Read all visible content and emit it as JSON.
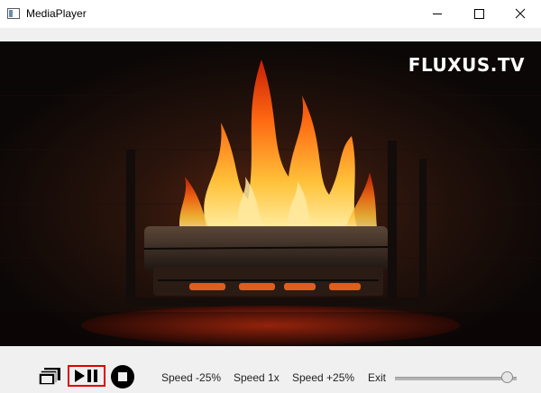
{
  "window": {
    "title": "MediaPlayer",
    "minimize_icon": "minimize-icon",
    "maximize_icon": "maximize-icon",
    "close_icon": "close-icon"
  },
  "video": {
    "watermark": "FLUXUS.TV"
  },
  "controls": {
    "fullscreen_icon": "fullscreen-icon",
    "playpause_icon": "play-pause-icon",
    "stop_icon": "stop-icon",
    "speed_down_label": "Speed -25%",
    "speed_normal_label": "Speed 1x",
    "speed_up_label": "Speed +25%",
    "exit_label": "Exit",
    "volume_level": 0.97,
    "playpause_highlight_color": "#e00000"
  }
}
